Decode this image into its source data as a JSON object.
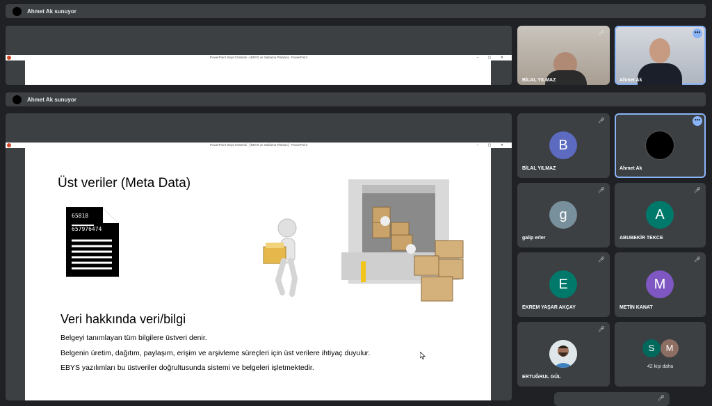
{
  "top_bar": {
    "presenter_text": "Ahmet Ak sunuyor"
  },
  "second_bar": {
    "presenter_text": "Ahmet Ak sunuyor"
  },
  "ppt_window_title": "PowerPoint Slayt Gösterisi - [EBYS ve Saklama Planları] - PowerPoint",
  "ppt_window_controls": "– ▢ ✕",
  "slide": {
    "heading": "Üst veriler (Meta Data)",
    "doc_numbers": [
      "65818",
      "657976474"
    ],
    "subheading": "Veri hakkında veri/bilgi",
    "lines": [
      "Belgeyi tanımlayan tüm bilgilere üstveri denir.",
      "Belgenin üretim, dağıtım, paylaşım, erişim ve arşivleme süreçleri için üst verilere ihtiyaç duyulur.",
      "EBYS yazılımları bu üstveriler doğrultusunda sistemi ve belgeleri işletmektedir."
    ]
  },
  "top_videos": [
    {
      "name": "BİLAL YILMAZ"
    },
    {
      "name": "Ahmet Ak"
    }
  ],
  "participants": [
    {
      "name": "BİLAL YILMAZ",
      "initial": "B",
      "color": "#5c6bc0"
    },
    {
      "name": "Ahmet Ak",
      "initial": "",
      "color": "#000000"
    },
    {
      "name": "galip erler",
      "initial": "g",
      "color": "#78909c"
    },
    {
      "name": "ABUBEKİR TEKCE",
      "initial": "A",
      "color": "#00796b"
    },
    {
      "name": "EKREM YAŞAR AKÇAY",
      "initial": "E",
      "color": "#00796b"
    },
    {
      "name": "METİN KANAT",
      "initial": "M",
      "color": "#7e57c2"
    },
    {
      "name": "ERTUĞRUL GÜL",
      "initial": "",
      "color": "#cfd8dc"
    }
  ],
  "others": {
    "initials": [
      "S",
      "M"
    ],
    "label": "42 kişi daha",
    "colors": [
      "#00695c",
      "#8d6e63"
    ]
  },
  "icons": {
    "mic_off": "mic-off-icon",
    "more": "more-options-icon"
  },
  "accent_color": "#8ab4f8"
}
